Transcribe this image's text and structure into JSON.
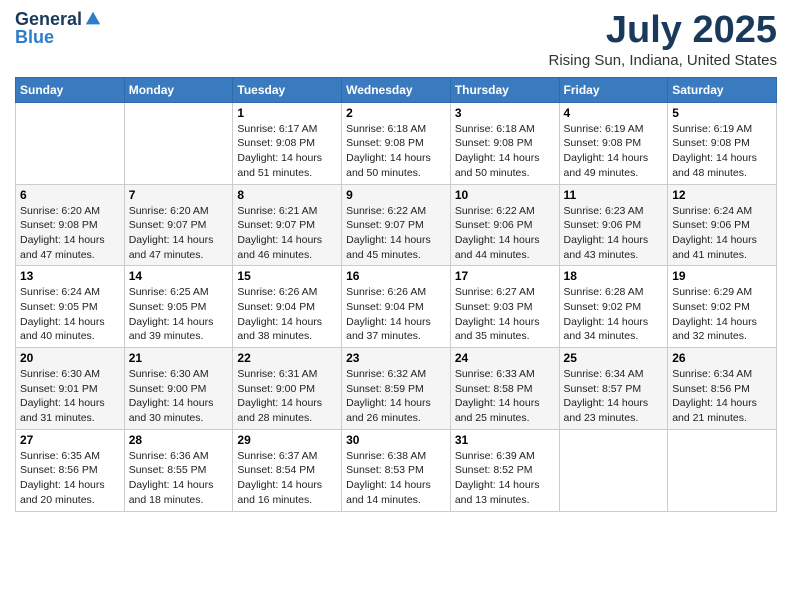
{
  "header": {
    "logo_general": "General",
    "logo_blue": "Blue",
    "title": "July 2025",
    "subtitle": "Rising Sun, Indiana, United States"
  },
  "calendar": {
    "days_of_week": [
      "Sunday",
      "Monday",
      "Tuesday",
      "Wednesday",
      "Thursday",
      "Friday",
      "Saturday"
    ],
    "weeks": [
      [
        {
          "day": null
        },
        {
          "day": null
        },
        {
          "day": "1",
          "sunrise": "Sunrise: 6:17 AM",
          "sunset": "Sunset: 9:08 PM",
          "daylight": "Daylight: 14 hours and 51 minutes."
        },
        {
          "day": "2",
          "sunrise": "Sunrise: 6:18 AM",
          "sunset": "Sunset: 9:08 PM",
          "daylight": "Daylight: 14 hours and 50 minutes."
        },
        {
          "day": "3",
          "sunrise": "Sunrise: 6:18 AM",
          "sunset": "Sunset: 9:08 PM",
          "daylight": "Daylight: 14 hours and 50 minutes."
        },
        {
          "day": "4",
          "sunrise": "Sunrise: 6:19 AM",
          "sunset": "Sunset: 9:08 PM",
          "daylight": "Daylight: 14 hours and 49 minutes."
        },
        {
          "day": "5",
          "sunrise": "Sunrise: 6:19 AM",
          "sunset": "Sunset: 9:08 PM",
          "daylight": "Daylight: 14 hours and 48 minutes."
        }
      ],
      [
        {
          "day": "6",
          "sunrise": "Sunrise: 6:20 AM",
          "sunset": "Sunset: 9:08 PM",
          "daylight": "Daylight: 14 hours and 47 minutes."
        },
        {
          "day": "7",
          "sunrise": "Sunrise: 6:20 AM",
          "sunset": "Sunset: 9:07 PM",
          "daylight": "Daylight: 14 hours and 47 minutes."
        },
        {
          "day": "8",
          "sunrise": "Sunrise: 6:21 AM",
          "sunset": "Sunset: 9:07 PM",
          "daylight": "Daylight: 14 hours and 46 minutes."
        },
        {
          "day": "9",
          "sunrise": "Sunrise: 6:22 AM",
          "sunset": "Sunset: 9:07 PM",
          "daylight": "Daylight: 14 hours and 45 minutes."
        },
        {
          "day": "10",
          "sunrise": "Sunrise: 6:22 AM",
          "sunset": "Sunset: 9:06 PM",
          "daylight": "Daylight: 14 hours and 44 minutes."
        },
        {
          "day": "11",
          "sunrise": "Sunrise: 6:23 AM",
          "sunset": "Sunset: 9:06 PM",
          "daylight": "Daylight: 14 hours and 43 minutes."
        },
        {
          "day": "12",
          "sunrise": "Sunrise: 6:24 AM",
          "sunset": "Sunset: 9:06 PM",
          "daylight": "Daylight: 14 hours and 41 minutes."
        }
      ],
      [
        {
          "day": "13",
          "sunrise": "Sunrise: 6:24 AM",
          "sunset": "Sunset: 9:05 PM",
          "daylight": "Daylight: 14 hours and 40 minutes."
        },
        {
          "day": "14",
          "sunrise": "Sunrise: 6:25 AM",
          "sunset": "Sunset: 9:05 PM",
          "daylight": "Daylight: 14 hours and 39 minutes."
        },
        {
          "day": "15",
          "sunrise": "Sunrise: 6:26 AM",
          "sunset": "Sunset: 9:04 PM",
          "daylight": "Daylight: 14 hours and 38 minutes."
        },
        {
          "day": "16",
          "sunrise": "Sunrise: 6:26 AM",
          "sunset": "Sunset: 9:04 PM",
          "daylight": "Daylight: 14 hours and 37 minutes."
        },
        {
          "day": "17",
          "sunrise": "Sunrise: 6:27 AM",
          "sunset": "Sunset: 9:03 PM",
          "daylight": "Daylight: 14 hours and 35 minutes."
        },
        {
          "day": "18",
          "sunrise": "Sunrise: 6:28 AM",
          "sunset": "Sunset: 9:02 PM",
          "daylight": "Daylight: 14 hours and 34 minutes."
        },
        {
          "day": "19",
          "sunrise": "Sunrise: 6:29 AM",
          "sunset": "Sunset: 9:02 PM",
          "daylight": "Daylight: 14 hours and 32 minutes."
        }
      ],
      [
        {
          "day": "20",
          "sunrise": "Sunrise: 6:30 AM",
          "sunset": "Sunset: 9:01 PM",
          "daylight": "Daylight: 14 hours and 31 minutes."
        },
        {
          "day": "21",
          "sunrise": "Sunrise: 6:30 AM",
          "sunset": "Sunset: 9:00 PM",
          "daylight": "Daylight: 14 hours and 30 minutes."
        },
        {
          "day": "22",
          "sunrise": "Sunrise: 6:31 AM",
          "sunset": "Sunset: 9:00 PM",
          "daylight": "Daylight: 14 hours and 28 minutes."
        },
        {
          "day": "23",
          "sunrise": "Sunrise: 6:32 AM",
          "sunset": "Sunset: 8:59 PM",
          "daylight": "Daylight: 14 hours and 26 minutes."
        },
        {
          "day": "24",
          "sunrise": "Sunrise: 6:33 AM",
          "sunset": "Sunset: 8:58 PM",
          "daylight": "Daylight: 14 hours and 25 minutes."
        },
        {
          "day": "25",
          "sunrise": "Sunrise: 6:34 AM",
          "sunset": "Sunset: 8:57 PM",
          "daylight": "Daylight: 14 hours and 23 minutes."
        },
        {
          "day": "26",
          "sunrise": "Sunrise: 6:34 AM",
          "sunset": "Sunset: 8:56 PM",
          "daylight": "Daylight: 14 hours and 21 minutes."
        }
      ],
      [
        {
          "day": "27",
          "sunrise": "Sunrise: 6:35 AM",
          "sunset": "Sunset: 8:56 PM",
          "daylight": "Daylight: 14 hours and 20 minutes."
        },
        {
          "day": "28",
          "sunrise": "Sunrise: 6:36 AM",
          "sunset": "Sunset: 8:55 PM",
          "daylight": "Daylight: 14 hours and 18 minutes."
        },
        {
          "day": "29",
          "sunrise": "Sunrise: 6:37 AM",
          "sunset": "Sunset: 8:54 PM",
          "daylight": "Daylight: 14 hours and 16 minutes."
        },
        {
          "day": "30",
          "sunrise": "Sunrise: 6:38 AM",
          "sunset": "Sunset: 8:53 PM",
          "daylight": "Daylight: 14 hours and 14 minutes."
        },
        {
          "day": "31",
          "sunrise": "Sunrise: 6:39 AM",
          "sunset": "Sunset: 8:52 PM",
          "daylight": "Daylight: 14 hours and 13 minutes."
        },
        {
          "day": null
        },
        {
          "day": null
        }
      ]
    ]
  }
}
